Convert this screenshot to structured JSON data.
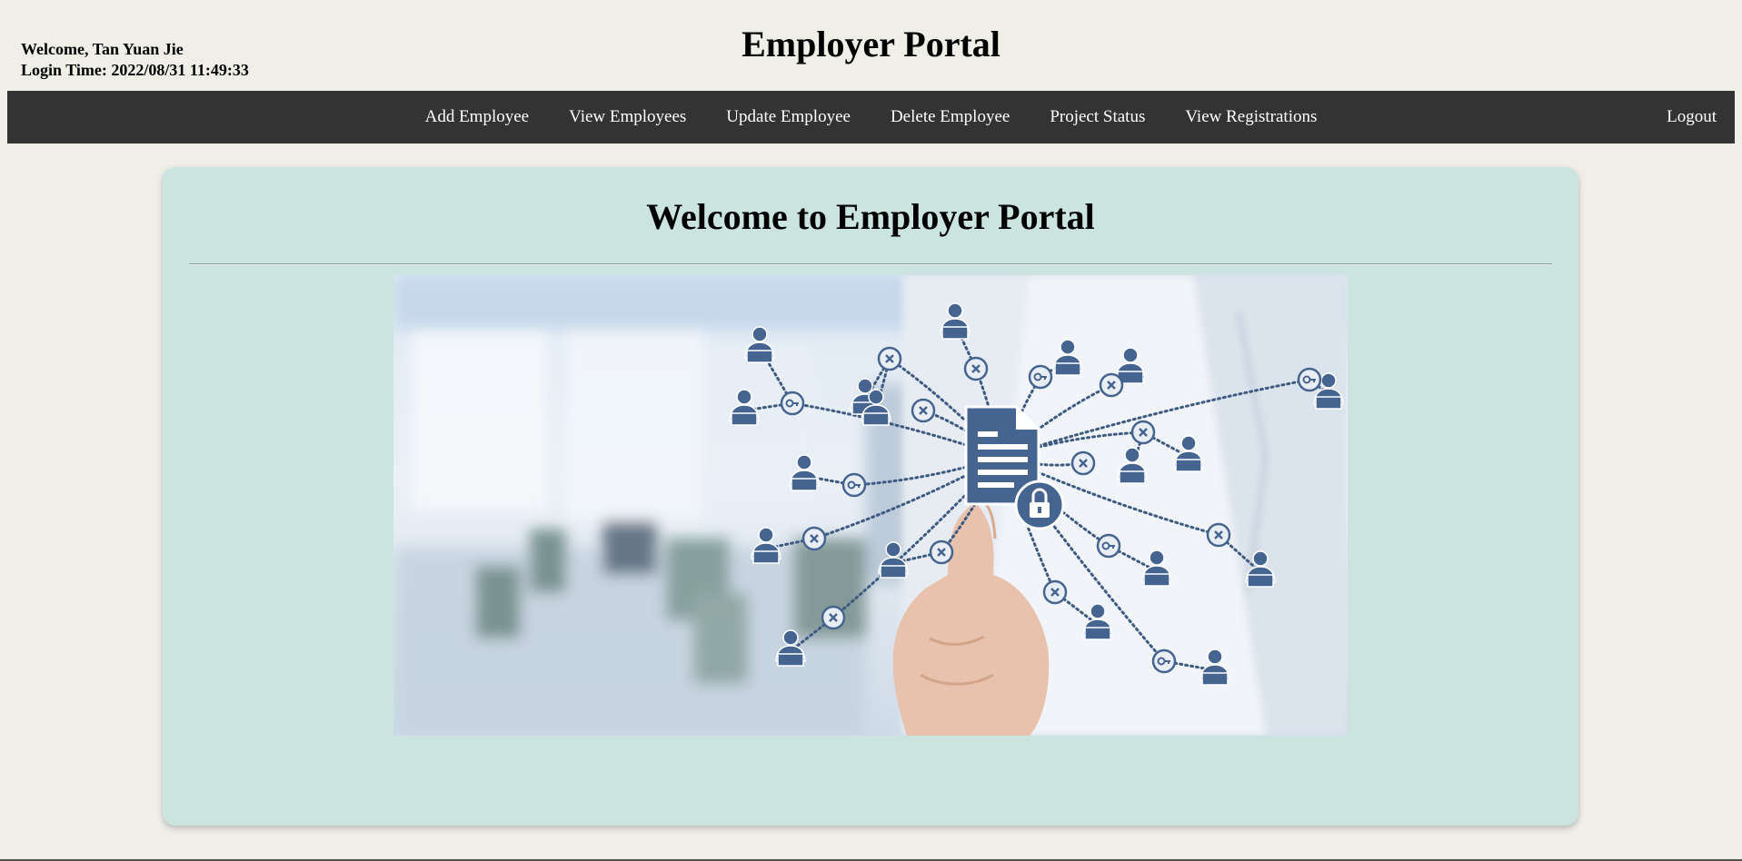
{
  "header": {
    "welcome": "Welcome, Tan Yuan Jie",
    "login_time": "Login Time: 2022/08/31 11:49:33",
    "title": "Employer Portal"
  },
  "nav": {
    "items": [
      {
        "label": "Add Employee"
      },
      {
        "label": "View Employees"
      },
      {
        "label": "Update Employee"
      },
      {
        "label": "Delete Employee"
      },
      {
        "label": "Project Status"
      },
      {
        "label": "View Registrations"
      }
    ],
    "logout": "Logout"
  },
  "main": {
    "title": "Welcome to Employer Portal",
    "image_icon": "network-document-illustration"
  },
  "colors": {
    "page_bg": "#efeee7",
    "nav_bg": "#333333",
    "card_bg": "#cbe4e0",
    "icon_blue": "#45648f"
  }
}
